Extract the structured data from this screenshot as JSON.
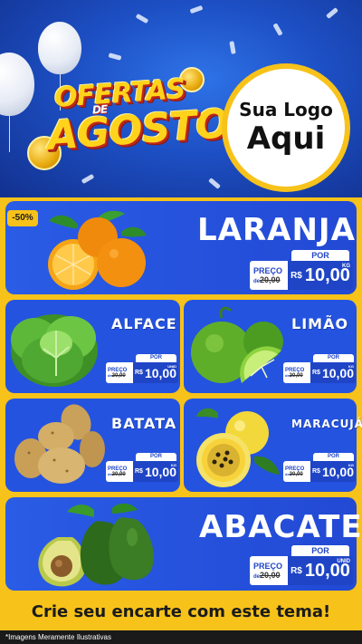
{
  "header": {
    "title_line1": "OFERTAS",
    "title_line2": "DE",
    "title_line3": "AGOSTO",
    "logo_line1": "Sua Logo",
    "logo_line2": "Aqui"
  },
  "colors": {
    "brand_blue": "#2453e0",
    "brand_yellow": "#f7c21a",
    "price_blue": "#1f45c6"
  },
  "products": [
    {
      "name": "LARANJA",
      "discount": "-50%",
      "por": "POR",
      "preco_label": "PREÇO",
      "old_prefix": "de",
      "old_price": "20,00",
      "currency": "R$",
      "price": "10,00",
      "unit": "KG",
      "icon": "orange-icon"
    },
    {
      "name": "ALFACE",
      "por": "POR",
      "preco_label": "PREÇO",
      "old_prefix": "de",
      "old_price": "20,00",
      "currency": "R$",
      "price": "10,00",
      "unit": "UNID",
      "icon": "lettuce-icon"
    },
    {
      "name": "LIMÃO",
      "por": "POR",
      "preco_label": "PREÇO",
      "old_prefix": "de",
      "old_price": "20,00",
      "currency": "R$",
      "price": "10,00",
      "unit": "KG",
      "icon": "lime-icon"
    },
    {
      "name": "BATATA",
      "por": "POR",
      "preco_label": "PREÇO",
      "old_prefix": "de",
      "old_price": "20,00",
      "currency": "R$",
      "price": "10,00",
      "unit": "KG",
      "icon": "potato-icon"
    },
    {
      "name": "MARACUJÁ",
      "por": "POR",
      "preco_label": "PREÇO",
      "old_prefix": "de",
      "old_price": "20,00",
      "currency": "R$",
      "price": "10,00",
      "unit": "KG",
      "icon": "passion-fruit-icon"
    },
    {
      "name": "ABACATE",
      "por": "POR",
      "preco_label": "PREÇO",
      "old_prefix": "de",
      "old_price": "20,00",
      "currency": "R$",
      "price": "10,00",
      "unit": "UNID",
      "icon": "avocado-icon"
    }
  ],
  "cta": "Crie seu encarte com este tema!",
  "footer": "*Imagens Meramente Ilustrativas"
}
